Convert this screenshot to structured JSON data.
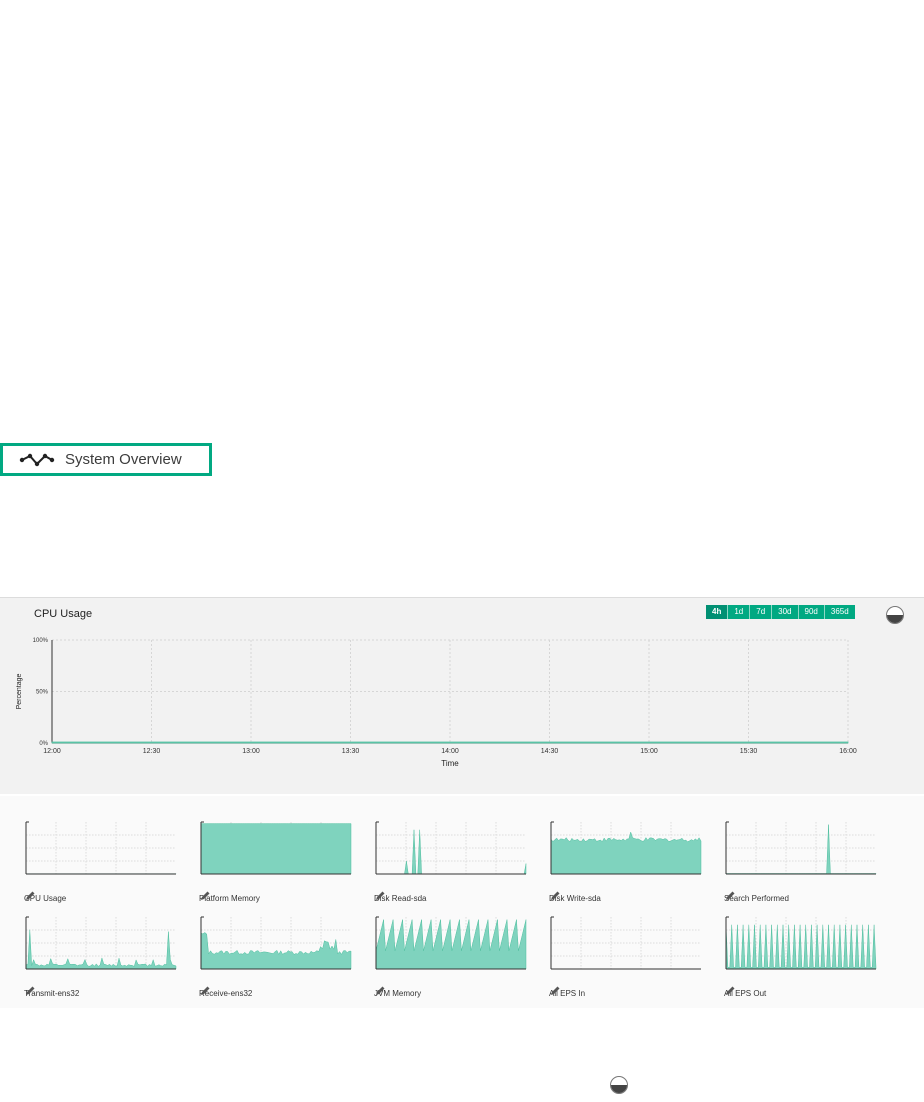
{
  "system_overview": {
    "label": "System Overview",
    "icon": "trend-line-icon"
  },
  "main_chart": {
    "title": "CPU Usage",
    "time_ranges": [
      {
        "label": "4h",
        "active": true
      },
      {
        "label": "1d",
        "active": false
      },
      {
        "label": "7d",
        "active": false
      },
      {
        "label": "30d",
        "active": false
      },
      {
        "label": "90d",
        "active": false
      },
      {
        "label": "365d",
        "active": false
      }
    ]
  },
  "chart_data": {
    "type": "area",
    "title": "CPU Usage",
    "xlabel": "Time",
    "ylabel": "Percentage",
    "x": [
      "12:00",
      "12:30",
      "13:00",
      "13:30",
      "14:00",
      "14:30",
      "15:00",
      "15:30",
      "16:00"
    ],
    "y_ticks": [
      "0%",
      "50%",
      "100%"
    ],
    "ylim": [
      0,
      100
    ],
    "values": [
      1,
      1,
      1,
      1,
      1,
      1,
      1,
      1,
      1
    ],
    "grid": true,
    "color": "#7fd3be"
  },
  "mini_charts": [
    {
      "label": "CPU Usage",
      "kind": "flat"
    },
    {
      "label": "Platform Memory",
      "kind": "full"
    },
    {
      "label": "Disk Read-sda",
      "kind": "spikes-few"
    },
    {
      "label": "Disk Write-sda",
      "kind": "high-noisy"
    },
    {
      "label": "Search Performed",
      "kind": "single-spike"
    },
    {
      "label": "Transmit-ens32",
      "kind": "low-spikes"
    },
    {
      "label": "Receive-ens32",
      "kind": "mid-noisy"
    },
    {
      "label": "JVM Memory",
      "kind": "sawtooth"
    },
    {
      "label": "All EPS In",
      "kind": "empty"
    },
    {
      "label": "All EPS Out",
      "kind": "comb"
    }
  ],
  "colors": {
    "accent": "#01a982",
    "area": "#7fd3be",
    "area_stroke": "#4fbf9f"
  },
  "edit_icon": "pencil-icon",
  "panel_toggle_icon": "half-circle-toggle-icon"
}
